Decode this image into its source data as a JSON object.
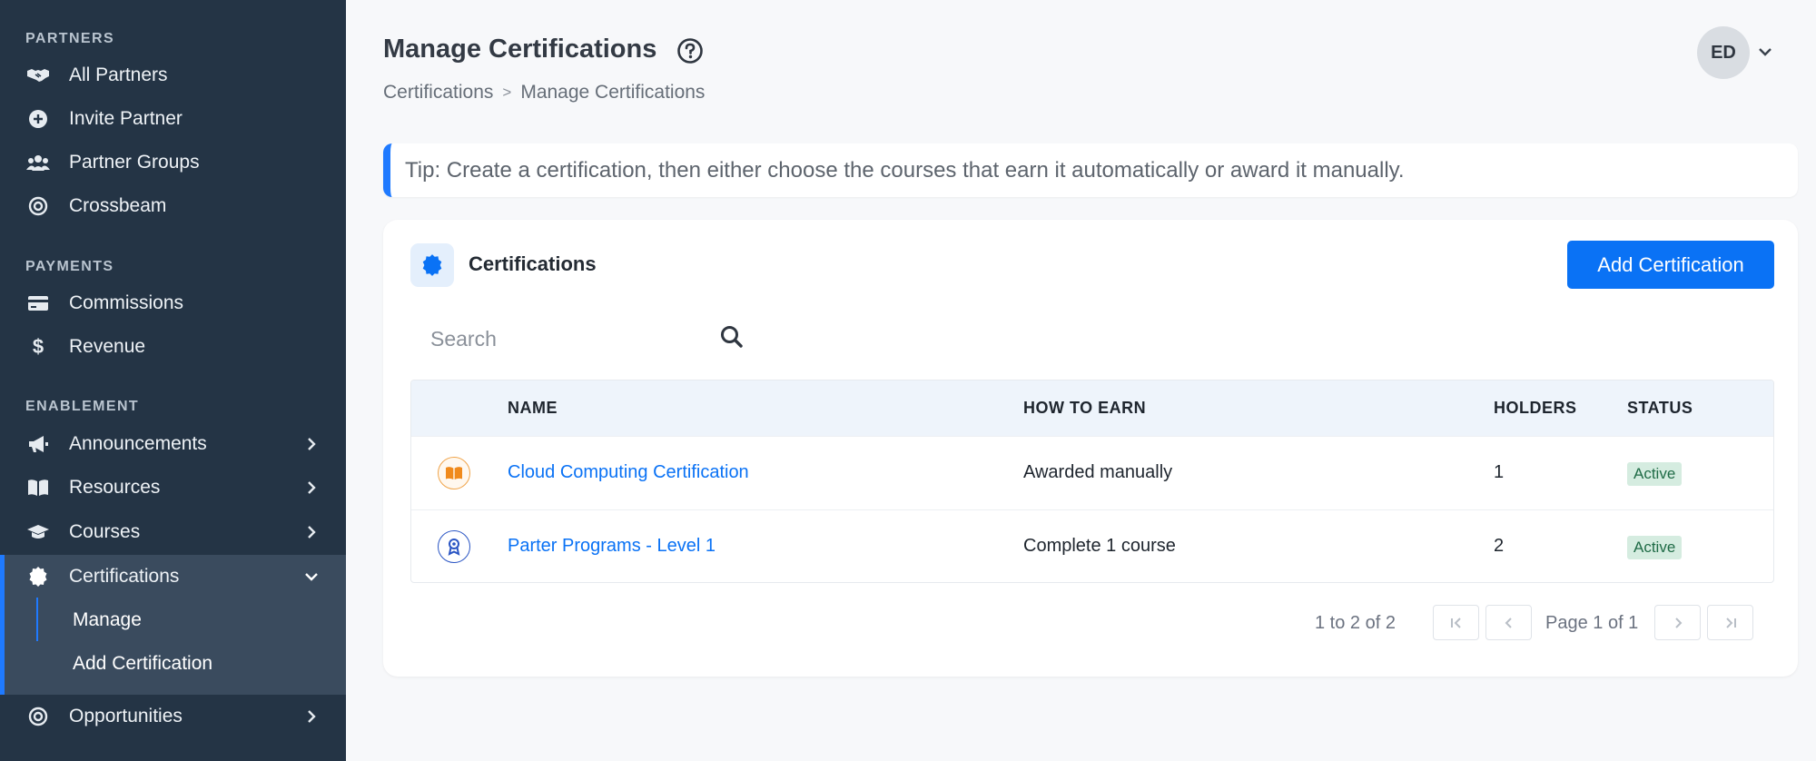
{
  "sidebar": {
    "sections": [
      {
        "label": "PARTNERS"
      },
      {
        "label": "PAYMENTS"
      },
      {
        "label": "ENABLEMENT"
      }
    ],
    "items": [
      {
        "label": "All Partners",
        "icon": "handshake-icon"
      },
      {
        "label": "Invite Partner",
        "icon": "plus-circle-icon"
      },
      {
        "label": "Partner Groups",
        "icon": "users-icon"
      },
      {
        "label": "Crossbeam",
        "icon": "target-icon"
      },
      {
        "label": "Commissions",
        "icon": "credit-card-icon"
      },
      {
        "label": "Revenue",
        "icon": "dollar-icon"
      },
      {
        "label": "Announcements",
        "icon": "megaphone-icon"
      },
      {
        "label": "Resources",
        "icon": "book-icon"
      },
      {
        "label": "Courses",
        "icon": "graduation-cap-icon"
      },
      {
        "label": "Certifications",
        "icon": "certificate-icon"
      },
      {
        "label": "Opportunities",
        "icon": "target-icon"
      }
    ],
    "certifications_sub": [
      {
        "label": "Manage"
      },
      {
        "label": "Add Certification"
      }
    ]
  },
  "header": {
    "title": "Manage Certifications",
    "breadcrumb": [
      "Certifications",
      ">",
      "Manage Certifications"
    ],
    "avatar_initials": "ED"
  },
  "tip": "Tip: Create a certification, then either choose the courses that earn it automatically or award it manually.",
  "card": {
    "title": "Certifications",
    "add_button": "Add Certification",
    "search_placeholder": "Search"
  },
  "table": {
    "columns": [
      "NAME",
      "HOW TO EARN",
      "HOLDERS",
      "STATUS"
    ],
    "rows": [
      {
        "name": "Cloud Computing Certification",
        "how_to_earn": "Awarded manually",
        "holders": "1",
        "status": "Active",
        "icon": "book-open-icon"
      },
      {
        "name": "Parter Programs - Level 1",
        "how_to_earn": "Complete 1 course",
        "holders": "2",
        "status": "Active",
        "icon": "award-icon"
      }
    ]
  },
  "pagination": {
    "count": "1 to 2 of 2",
    "page_text": "Page 1 of 1"
  },
  "colors": {
    "sidebar_bg": "#243445",
    "accent": "#0a72f5",
    "status_active_bg": "#d5ece0"
  }
}
